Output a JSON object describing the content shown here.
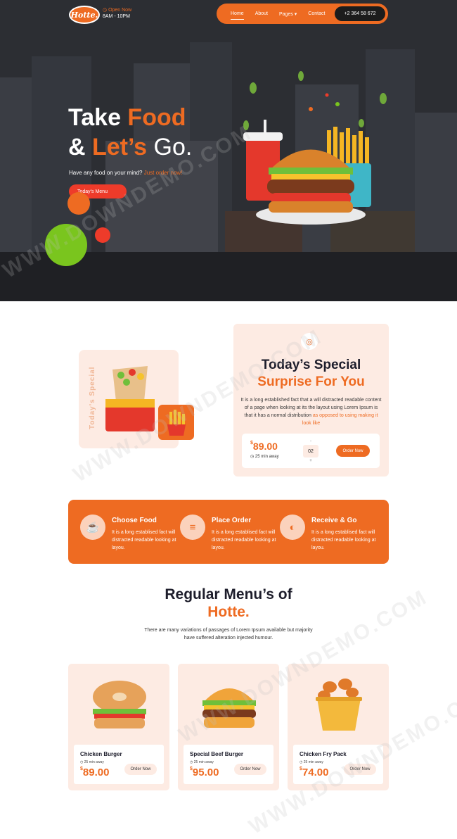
{
  "header": {
    "logo_text": "Hotte.",
    "open_label": "Open Now",
    "open_hours": "8AM - 10PM",
    "nav": [
      {
        "label": "Home"
      },
      {
        "label": "About"
      },
      {
        "label": "Pages ▾"
      },
      {
        "label": "Contact"
      }
    ],
    "phone": "+2 364 58 672"
  },
  "hero": {
    "title_a": "Take ",
    "title_b": "Food",
    "title_c": "& ",
    "title_d": "Let’s ",
    "title_e": "Go.",
    "subtitle_a": "Have any food on your mind? ",
    "subtitle_b": "Just order now!",
    "button": "Today's Menu",
    "colors": {
      "accent": "#ee6b22",
      "red": "#ee3b2a",
      "green": "#7ac51e"
    }
  },
  "special": {
    "side_label": "Today's Special",
    "title": "Today’s Special",
    "subtitle": "Surprise For You",
    "desc_a": "It is a long established fact that a will distracted readable content of a page when looking at its the layout using Lorem Ipsum is that it has a normal distribution ",
    "desc_b": "as opposed to using making it look like",
    "currency": "$",
    "price": "89.00",
    "time": "25 min away",
    "qty_minus": "-",
    "qty": "02",
    "qty_plus": "+",
    "order_label": "Order Now"
  },
  "steps": [
    {
      "title": "Choose Food",
      "desc": "It is a long establised fact will distracted readable looking at layou."
    },
    {
      "title": "Place Order",
      "desc": "It is a long establised fact will distracted readable looking at layou."
    },
    {
      "title": "Receive & Go",
      "desc": "It is a long establised fact will distracted readable looking at layou."
    }
  ],
  "menu": {
    "title": "Regular Menu’s of",
    "brand": "Hotte.",
    "desc": "There are many variations of passages of Lorem Ipsum available but majority have suffered alteration injected humour.",
    "items": [
      {
        "name": "Chicken Burger",
        "time": "25 min away",
        "currency": "$",
        "price": "89.00",
        "order": "Order Now"
      },
      {
        "name": "Special Beef Burger",
        "time": "25 min away",
        "currency": "$",
        "price": "95.00",
        "order": "Order Now"
      },
      {
        "name": "Chicken Fry Pack",
        "time": "25 min away",
        "currency": "$",
        "price": "74.00",
        "order": "Order Now"
      }
    ]
  },
  "watermark": "WWW.DOWNDEMO.COM"
}
